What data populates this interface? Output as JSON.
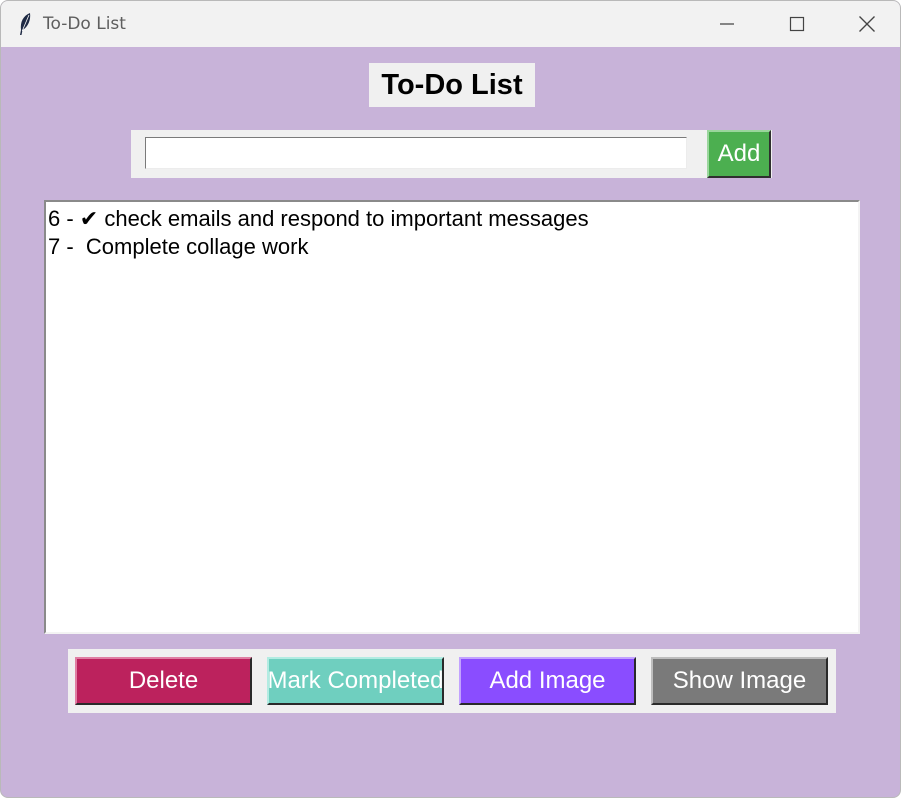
{
  "window": {
    "title": "To-Do List",
    "app_icon": "feather-icon",
    "controls": {
      "minimize_icon": "minimize-icon",
      "maximize_icon": "maximize-icon",
      "close_icon": "close-icon"
    }
  },
  "heading": "To-Do List",
  "entry": {
    "value": "",
    "placeholder": ""
  },
  "add_button": "Add",
  "tasks": [
    "6 - ✔ check emails and respond to important messages",
    "7 -  Complete collage work"
  ],
  "buttons": {
    "delete": "Delete",
    "mark_completed": "Mark Completed",
    "add_image": "Add Image",
    "show_image": "Show Image"
  },
  "colors": {
    "background": "#c8b3d9",
    "add": "#4caf50",
    "delete": "#bc225d",
    "mark_completed": "#6fcfbf",
    "add_image": "#8a4dff",
    "show_image": "#7a7a7a"
  }
}
